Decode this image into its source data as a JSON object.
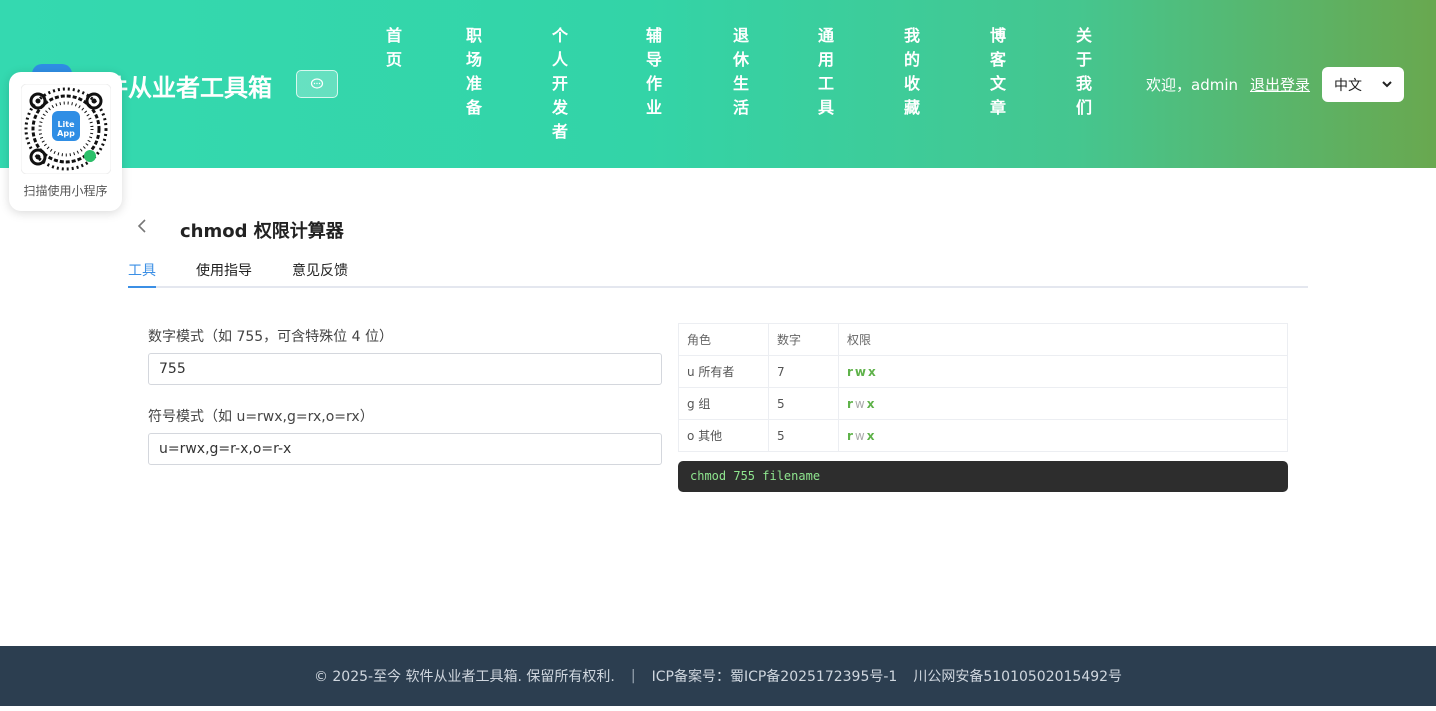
{
  "header": {
    "brand_title": "件从业者工具箱",
    "nav": [
      "首页",
      "职场准备",
      "个人开发者",
      "辅导作业",
      "退休生活",
      "通用工具",
      "我的收藏",
      "博客文章",
      "关于我们"
    ],
    "welcome": "欢迎，admin",
    "logout": "退出登录",
    "language": "中文"
  },
  "qr": {
    "logo_text": "Lite App",
    "caption": "扫描使用小程序"
  },
  "page": {
    "title": "chmod 权限计算器",
    "tabs": [
      "工具",
      "使用指导",
      "意见反馈"
    ]
  },
  "form": {
    "numeric_label": "数字模式（如 755，可含特殊位 4 位）",
    "numeric_value": "755",
    "symbolic_label": "符号模式（如 u=rwx,g=rx,o=rx）",
    "symbolic_value": "u=rwx,g=r-x,o=r-x"
  },
  "table": {
    "headers": [
      "角色",
      "数字",
      "权限"
    ],
    "rows": [
      {
        "role": "u 所有者",
        "digit": "7",
        "perms": [
          {
            "c": "r",
            "on": true
          },
          {
            "c": "w",
            "on": true
          },
          {
            "c": "x",
            "on": true
          }
        ]
      },
      {
        "role": "g 组",
        "digit": "5",
        "perms": [
          {
            "c": "r",
            "on": true
          },
          {
            "c": "w",
            "on": false
          },
          {
            "c": "x",
            "on": true
          }
        ]
      },
      {
        "role": "o 其他",
        "digit": "5",
        "perms": [
          {
            "c": "r",
            "on": true
          },
          {
            "c": "w",
            "on": false
          },
          {
            "c": "x",
            "on": true
          }
        ]
      }
    ]
  },
  "command": "chmod 755 filename",
  "footer": {
    "copyright": "© 2025-至今 软件从业者工具箱. 保留所有权利.",
    "separator": "|",
    "icp": "ICP备案号：蜀ICP备2025172395号-1",
    "gongan": "川公网安备51010502015492号"
  }
}
